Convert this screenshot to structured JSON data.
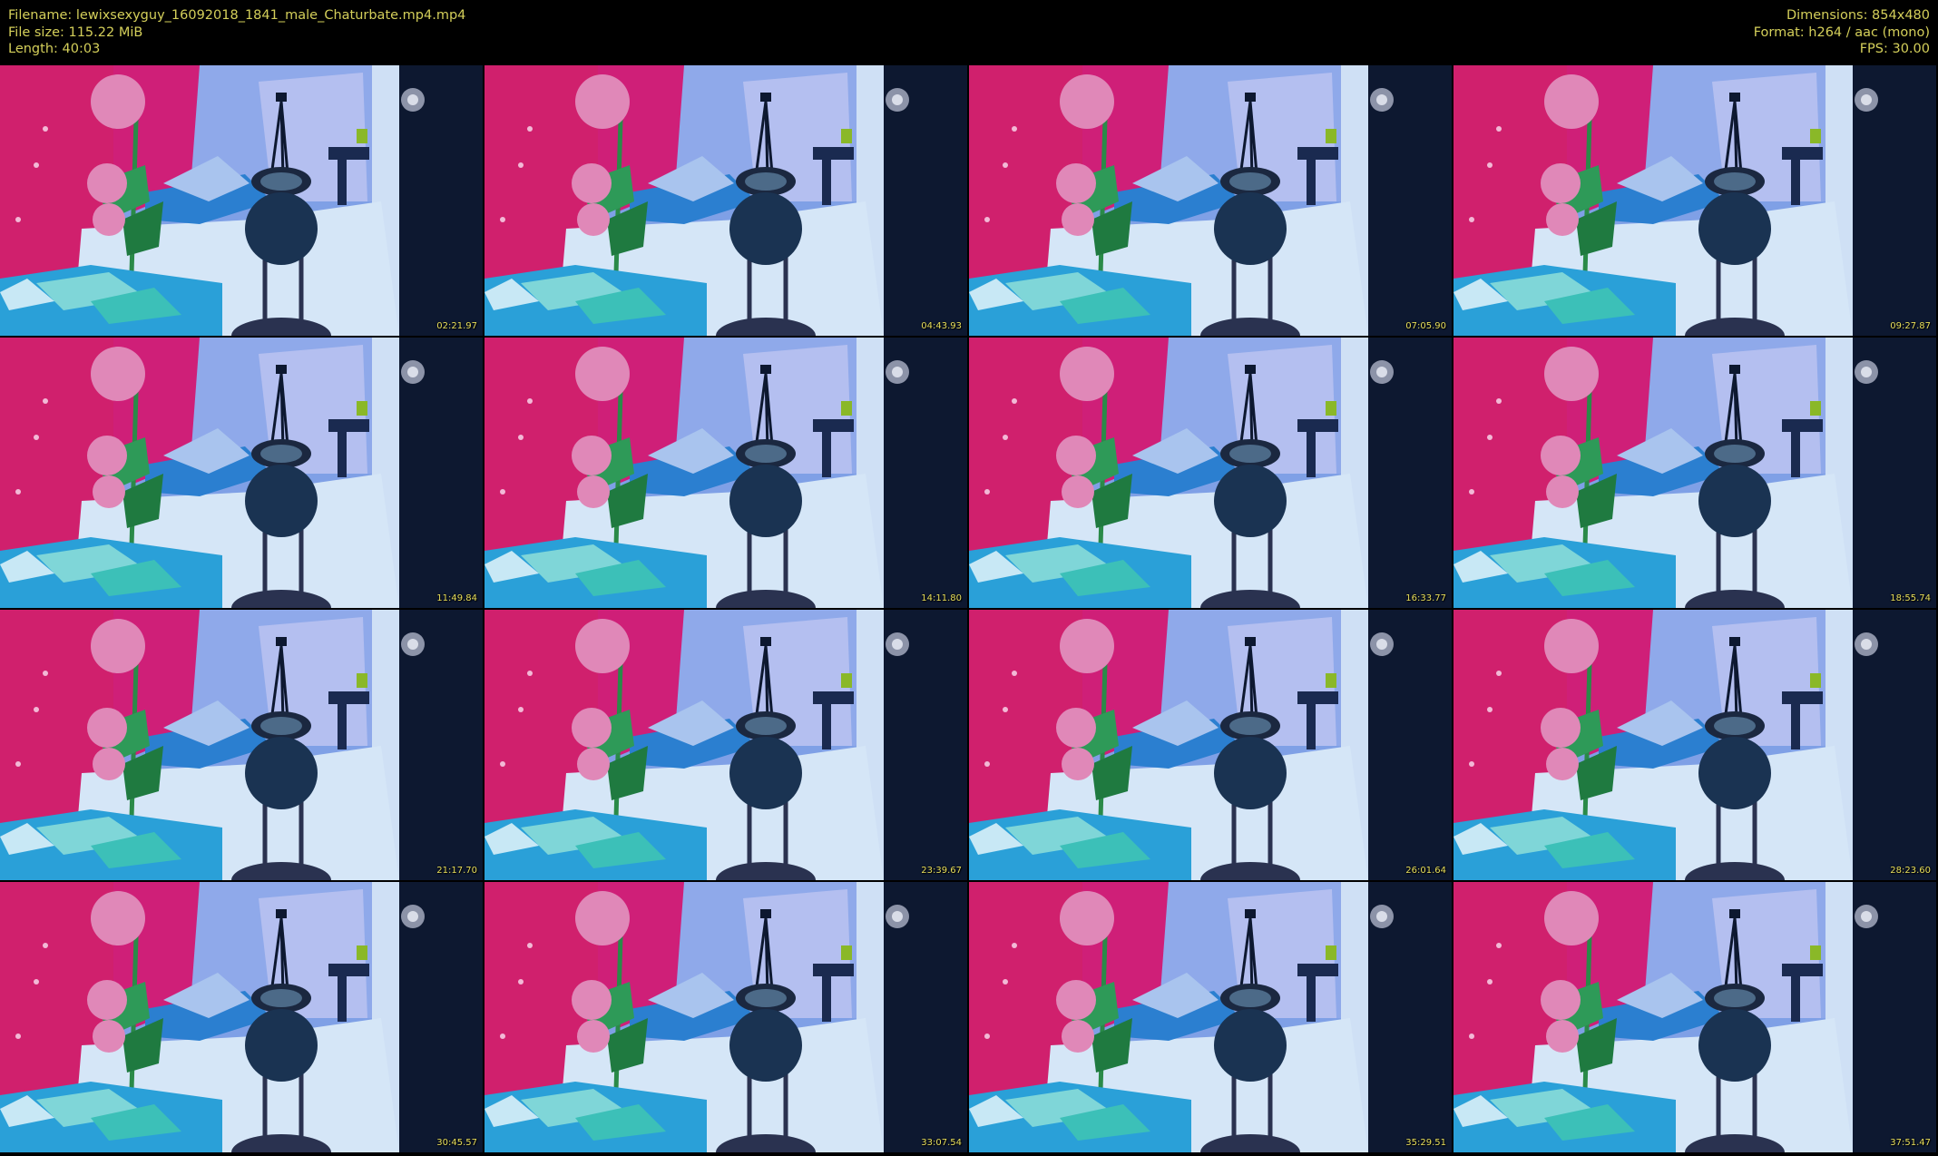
{
  "header": {
    "filename": "Filename: lewixsexyguy_16092018_1841_male_Chaturbate.mp4.mp4",
    "filesize": "File size: 115.22 MiB",
    "length": "Length: 40:03",
    "dimensions": "Dimensions: 854x480",
    "format": "Format: h264 / aac (mono)",
    "fps": "FPS: 30.00"
  },
  "thumbnails": [
    {
      "timestamp": "02:21.97"
    },
    {
      "timestamp": "04:43.93"
    },
    {
      "timestamp": "07:05.90"
    },
    {
      "timestamp": "09:27.87"
    },
    {
      "timestamp": "11:49.84"
    },
    {
      "timestamp": "14:11.80"
    },
    {
      "timestamp": "16:33.77"
    },
    {
      "timestamp": "18:55.74"
    },
    {
      "timestamp": "21:17.70"
    },
    {
      "timestamp": "23:39.67"
    },
    {
      "timestamp": "26:01.64"
    },
    {
      "timestamp": "28:23.60"
    },
    {
      "timestamp": "30:45.57"
    },
    {
      "timestamp": "33:07.54"
    },
    {
      "timestamp": "35:29.51"
    },
    {
      "timestamp": "37:51.47"
    }
  ],
  "colors": {
    "header_text": "#d4cf5a",
    "timestamp_text": "#e8df5c",
    "background": "#000000"
  }
}
